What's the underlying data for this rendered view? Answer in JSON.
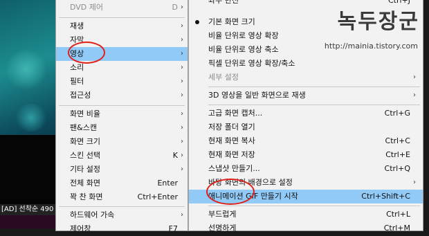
{
  "watermark": {
    "title": "녹두장군",
    "url": "http://mainia.tistory.com"
  },
  "video": {
    "ticker": "[AD] 선착순 490"
  },
  "main_menu": {
    "items": [
      {
        "label": "DVD 제어",
        "shortcut": "D",
        "arrow": "›"
      },
      {
        "label": "재생",
        "shortcut": "",
        "arrow": "›"
      },
      {
        "label": "자막",
        "shortcut": "",
        "arrow": "›"
      },
      {
        "label": "영상",
        "shortcut": "",
        "arrow": "›"
      },
      {
        "label": "소리",
        "shortcut": "",
        "arrow": "›"
      },
      {
        "label": "필터",
        "shortcut": "",
        "arrow": "›"
      },
      {
        "label": "접근성",
        "shortcut": "",
        "arrow": "›"
      },
      {
        "label": "화면 비율",
        "shortcut": "",
        "arrow": "›"
      },
      {
        "label": "팬&스캔",
        "shortcut": "",
        "arrow": "›"
      },
      {
        "label": "화면 크기",
        "shortcut": "",
        "arrow": "›"
      },
      {
        "label": "스킨 선택",
        "shortcut": "K",
        "arrow": "›"
      },
      {
        "label": "기타 설정",
        "shortcut": "",
        "arrow": "›"
      },
      {
        "label": "전체 화면",
        "shortcut": "Enter",
        "arrow": ""
      },
      {
        "label": "꽉 찬 화면",
        "shortcut": "Ctrl+Enter",
        "arrow": ""
      },
      {
        "label": "하드웨어 가속",
        "shortcut": "",
        "arrow": "›"
      },
      {
        "label": "제어창",
        "shortcut": "F7",
        "arrow": ""
      }
    ]
  },
  "sub_menu": {
    "top_partial": {
      "label": "좌우 반전",
      "shortcut": "Ctrl+J"
    },
    "items": [
      {
        "label": "기본 화면 크기",
        "shortcut": "",
        "arrow": ""
      },
      {
        "label": "비율 단위로 영상 확장",
        "shortcut": "",
        "arrow": ""
      },
      {
        "label": "비율 단위로 영상 축소",
        "shortcut": "",
        "arrow": ""
      },
      {
        "label": "픽셀 단위로 영상 확장/축소",
        "shortcut": "",
        "arrow": ""
      },
      {
        "label": "세부 설정",
        "shortcut": "",
        "arrow": "›"
      },
      {
        "label": "3D 영상을 일반 화면으로 재생",
        "shortcut": "",
        "arrow": "›"
      },
      {
        "label": "고급 화면 캡처...",
        "shortcut": "Ctrl+G",
        "arrow": ""
      },
      {
        "label": "저장 폴더 열기",
        "shortcut": "",
        "arrow": ""
      },
      {
        "label": "현재 화면 복사",
        "shortcut": "Ctrl+C",
        "arrow": ""
      },
      {
        "label": "현재 화면 저장",
        "shortcut": "Ctrl+E",
        "arrow": ""
      },
      {
        "label": "스냅샷 만들기...",
        "shortcut": "Ctrl+Q",
        "arrow": ""
      },
      {
        "label": "바탕 화면의 배경으로 설정",
        "shortcut": "",
        "arrow": "›"
      },
      {
        "label": "애니메이션 GIF 만들기 시작",
        "shortcut": "Ctrl+Shift+C",
        "arrow": ""
      },
      {
        "label": "부드럽게",
        "shortcut": "Ctrl+L",
        "arrow": ""
      },
      {
        "label": "선명하게",
        "shortcut": "Ctrl+M",
        "arrow": ""
      }
    ]
  }
}
